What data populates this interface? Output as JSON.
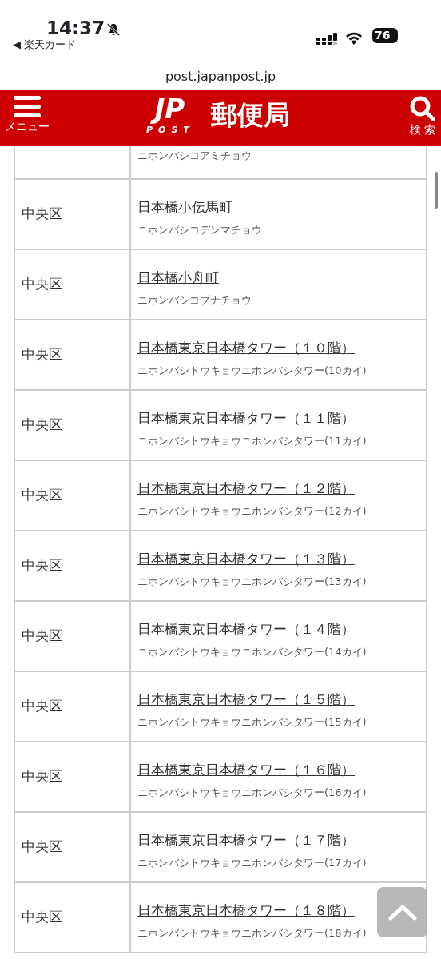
{
  "status_bar": {
    "time": "14:37",
    "back_app": "◀ 楽天カード",
    "battery": "76"
  },
  "url_bar": {
    "domain": "post.japanpost.jp"
  },
  "header": {
    "menu_label": "メニュー",
    "logo_mark": "JP",
    "logo_sub": "POST",
    "site_name": "郵便局",
    "search_label": "検 索"
  },
  "rows": [
    {
      "reading": "ニホンバシコアミチョウ"
    },
    {
      "ward": "中央区",
      "town": "日本橋小伝馬町",
      "reading": "ニホンバシコデンマチョウ"
    },
    {
      "ward": "中央区",
      "town": "日本橋小舟町",
      "reading": "ニホンバシコブナチョウ"
    },
    {
      "ward": "中央区",
      "town": "日本橋東京日本橋タワー（１０階）",
      "reading": "ニホンバシトウキョウニホンバシタワー(10カイ)"
    },
    {
      "ward": "中央区",
      "town": "日本橋東京日本橋タワー（１１階）",
      "reading": "ニホンバシトウキョウニホンバシタワー(11カイ)"
    },
    {
      "ward": "中央区",
      "town": "日本橋東京日本橋タワー（１２階）",
      "reading": "ニホンバシトウキョウニホンバシタワー(12カイ)"
    },
    {
      "ward": "中央区",
      "town": "日本橋東京日本橋タワー（１３階）",
      "reading": "ニホンバシトウキョウニホンバシタワー(13カイ)"
    },
    {
      "ward": "中央区",
      "town": "日本橋東京日本橋タワー（１４階）",
      "reading": "ニホンバシトウキョウニホンバシタワー(14カイ)"
    },
    {
      "ward": "中央区",
      "town": "日本橋東京日本橋タワー（１５階）",
      "reading": "ニホンバシトウキョウニホンバシタワー(15カイ)"
    },
    {
      "ward": "中央区",
      "town": "日本橋東京日本橋タワー（１６階）",
      "reading": "ニホンバシトウキョウニホンバシタワー(16カイ)"
    },
    {
      "ward": "中央区",
      "town": "日本橋東京日本橋タワー（１７階）",
      "reading": "ニホンバシトウキョウニホンバシタワー(17カイ)"
    },
    {
      "ward": "中央区",
      "town": "日本橋東京日本橋タワー（１８階）",
      "reading": "ニホンバシトウキョウニホンバシタワー(18カイ)"
    }
  ]
}
